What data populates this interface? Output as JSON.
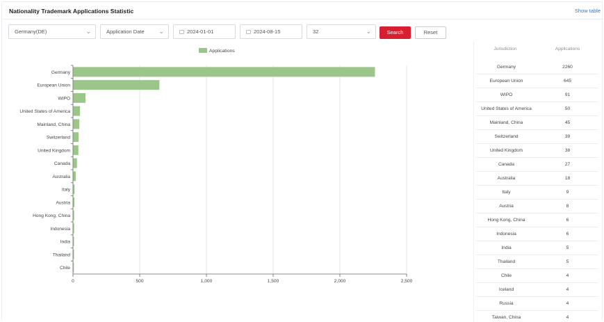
{
  "header": {
    "title": "Nationality Trademark Applications Statistic",
    "show_table": "Show table"
  },
  "filters": {
    "country": "Germany(DE)",
    "date_type": "Application Date",
    "start_date": "2024-01-01",
    "end_date": "2024-08-15",
    "limit": "32",
    "search_label": "Search",
    "reset_label": "Reset"
  },
  "colors": {
    "bar": "#9bc68a",
    "accent": "#d61f30",
    "link": "#3a73d6"
  },
  "table": {
    "col_jurisdiction": "Jurisdiction",
    "col_applications": "Applications",
    "rows": [
      {
        "jurisdiction": "Germany",
        "applications": "2260"
      },
      {
        "jurisdiction": "European Union",
        "applications": "645"
      },
      {
        "jurisdiction": "WIPO",
        "applications": "91"
      },
      {
        "jurisdiction": "United States of America",
        "applications": "50"
      },
      {
        "jurisdiction": "Mainland, China",
        "applications": "45"
      },
      {
        "jurisdiction": "Switzerland",
        "applications": "39"
      },
      {
        "jurisdiction": "United Kingdom",
        "applications": "38"
      },
      {
        "jurisdiction": "Canada",
        "applications": "27"
      },
      {
        "jurisdiction": "Australia",
        "applications": "18"
      },
      {
        "jurisdiction": "Italy",
        "applications": "9"
      },
      {
        "jurisdiction": "Austria",
        "applications": "8"
      },
      {
        "jurisdiction": "Hong Kong, China",
        "applications": "6"
      },
      {
        "jurisdiction": "Indonesia",
        "applications": "6"
      },
      {
        "jurisdiction": "India",
        "applications": "5"
      },
      {
        "jurisdiction": "Thailand",
        "applications": "5"
      },
      {
        "jurisdiction": "Chile",
        "applications": "4"
      },
      {
        "jurisdiction": "Iceland",
        "applications": "4"
      },
      {
        "jurisdiction": "Russia",
        "applications": "4"
      },
      {
        "jurisdiction": "Taiwan, China",
        "applications": "4"
      }
    ]
  },
  "chart_data": {
    "type": "bar",
    "orientation": "horizontal",
    "legend": "Applications",
    "categories": [
      "Germany",
      "European Union",
      "WIPO",
      "United States of America",
      "Mainland, China",
      "Switzerland",
      "United Kingdom",
      "Canada",
      "Australia",
      "Italy",
      "Austria",
      "Hong Kong, China",
      "Indonesia",
      "India",
      "Thailand",
      "Chile"
    ],
    "series": [
      {
        "name": "Applications",
        "values": [
          2260,
          645,
          91,
          50,
          45,
          39,
          38,
          27,
          18,
          9,
          8,
          6,
          6,
          5,
          5,
          4
        ]
      }
    ],
    "xlim": [
      0,
      2500
    ],
    "xticks": [
      "0",
      "500",
      "1,000",
      "1,500",
      "2,000",
      "2,500"
    ],
    "grid": true,
    "legend_position": "top-center"
  }
}
